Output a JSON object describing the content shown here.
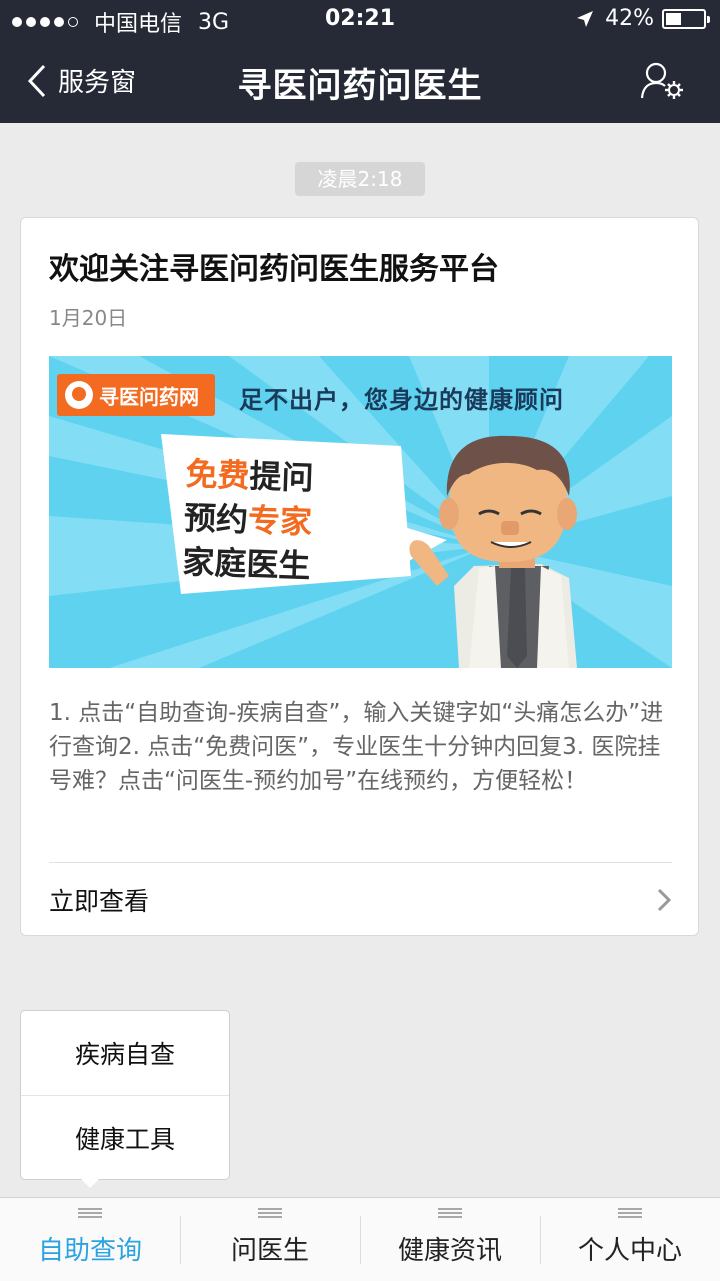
{
  "status_bar": {
    "carrier": "中国电信",
    "network": "3G",
    "time": "02:21",
    "battery": "42%",
    "battery_level": 0.42,
    "signal_dots_filled": 4
  },
  "navbar": {
    "back_label": "服务窗",
    "title": "寻医问药问医生"
  },
  "message": {
    "timestamp": "凌晨2:18",
    "title": "欢迎关注寻医问药问医生服务平台",
    "date": "1月20日",
    "banner": {
      "logo_text": "寻医问药网",
      "slogan": "足不出户，您身边的健康顾问",
      "sign_lines": [
        {
          "a": "免费",
          "b": "提问"
        },
        {
          "a": "预约",
          "b": "专家"
        },
        {
          "a": "家庭医生",
          "b": ""
        }
      ]
    },
    "description": "1. 点击“自助查询-疾病自查”，输入关键字如“头痛怎么办”进行查询2. 点击“免费问医”，专业医生十分钟内回复3. 医院挂号难？点击“问医生-预约加号”在线预约，方便轻松！",
    "link_label": "立即查看"
  },
  "popup_menu": {
    "items": [
      "疾病自查",
      "健康工具"
    ]
  },
  "tabbar": {
    "tabs": [
      {
        "label": "自助查询",
        "active": true
      },
      {
        "label": "问医生",
        "active": false
      },
      {
        "label": "健康资讯",
        "active": false
      },
      {
        "label": "个人中心",
        "active": false
      }
    ]
  },
  "colors": {
    "bar_bg": "#262a36",
    "accent": "#2aa3e0",
    "banner_bg": "#5fd2f0",
    "logo_orange": "#f26b21"
  }
}
